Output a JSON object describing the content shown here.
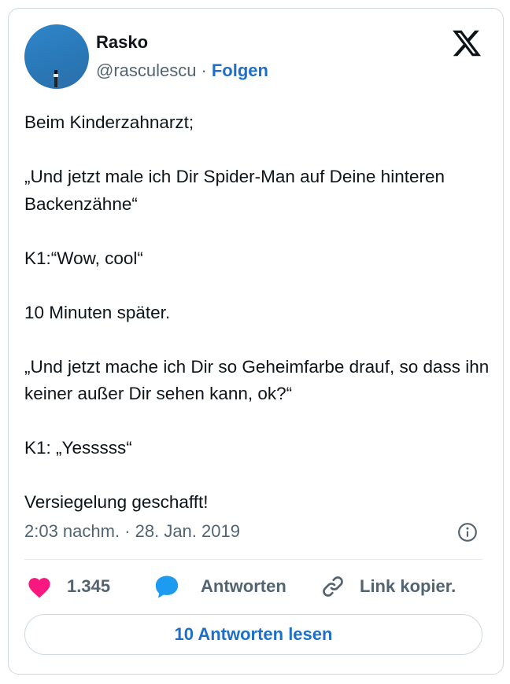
{
  "author": {
    "name": "Rasko",
    "handle": "@rasculescu",
    "separator": "·",
    "follow_label": "Folgen"
  },
  "tweet": {
    "paragraphs": [
      "Beim Kinderzahnarzt;",
      "„Und jetzt male ich Dir Spider-Man auf Deine hinteren Backenzähne“",
      "K1:“Wow, cool“",
      "10 Minuten später.",
      "„Und jetzt mache ich Dir so Geheimfarbe drauf, so dass ihn keiner außer Dir sehen kann, ok?“",
      "K1: „Yesssss“",
      "Versiegelung geschafft!"
    ],
    "timestamp": "2:03 nachm. · 28. Jan. 2019"
  },
  "actions": {
    "like_count": "1.345",
    "reply_label": "Antworten",
    "copy_link_label": "Link kopier."
  },
  "read_replies_label": "10 Antworten lesen",
  "icons": {
    "logo": "x-logo-icon",
    "info": "info-icon",
    "like": "heart-icon",
    "reply": "speech-bubble-icon",
    "copy": "link-icon"
  },
  "colors": {
    "text": "#0f1419",
    "muted": "#536471",
    "link": "#1d6fc8",
    "like": "#f91880",
    "reply_icon": "#1d9bf0",
    "border": "#cfd9de"
  }
}
